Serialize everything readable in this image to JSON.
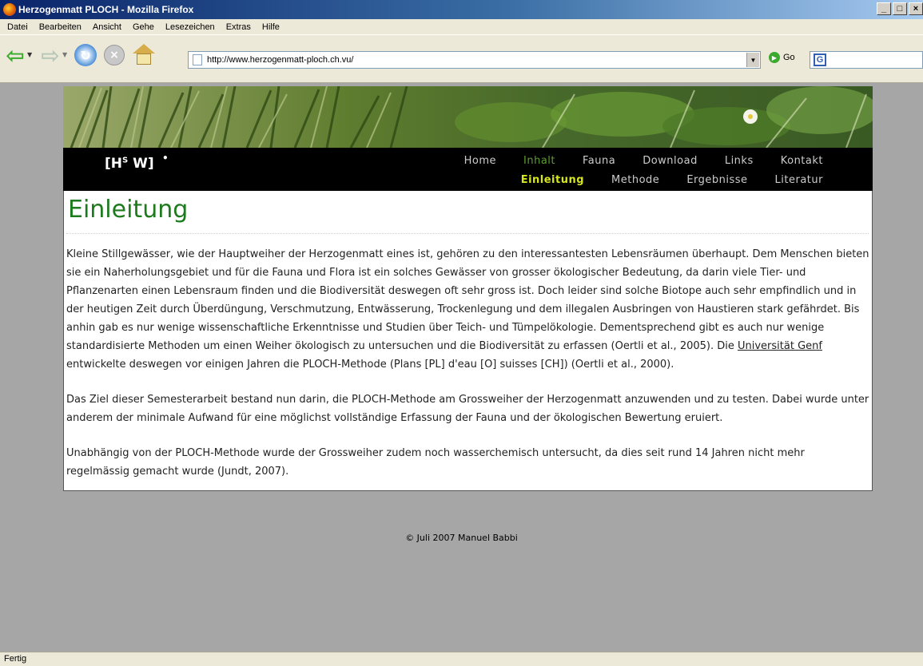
{
  "window": {
    "title": "Herzogenmatt PLOCH - Mozilla Firefox"
  },
  "menubar": [
    "Datei",
    "Bearbeiten",
    "Ansicht",
    "Gehe",
    "Lesezeichen",
    "Extras",
    "Hilfe"
  ],
  "toolbar": {
    "url": "http://www.herzogenmatt-ploch.ch.vu/",
    "go_label": "Go"
  },
  "site": {
    "logo": "[H",
    "logo_sup": "S",
    "logo_tail": " W]",
    "nav": [
      "Home",
      "Inhalt",
      "Fauna",
      "Download",
      "Links",
      "Kontakt"
    ],
    "nav_active": "Inhalt",
    "subnav": [
      "Einleitung",
      "Methode",
      "Ergebnisse",
      "Literatur"
    ],
    "subnav_active": "Einleitung"
  },
  "content": {
    "heading": "Einleitung",
    "p1_before_link": "Kleine Stillgewässer, wie der Hauptweiher der Herzogenmatt eines ist, gehören zu den interessantesten Lebensräumen überhaupt. Dem Menschen bieten sie ein Naherholungsgebiet und für die Fauna und Flora ist ein solches Gewässer von grosser ökologischer Bedeutung, da darin viele Tier- und Pflanzenarten einen Lebensraum finden und die Biodiversität deswegen oft sehr gross ist. Doch leider sind solche Biotope auch sehr empfindlich und in der heutigen Zeit durch Überdüngung, Verschmutzung, Entwässerung, Trockenlegung und dem illegalen Ausbringen von Haustieren stark gefährdet. Bis anhin gab es nur wenige wissenschaftliche Erkenntnisse und Studien über Teich- und Tümpelökologie. Dementsprechend gibt es auch nur wenige standardisierte Methoden um einen Weiher ökologisch zu untersuchen und die Biodiversität zu erfassen (Oertli et al., 2005). Die ",
    "p1_link": "Universität Genf",
    "p1_after_link": " entwickelte deswegen vor einigen Jahren die PLOCH-Methode (Plans [PL] d'eau [O] suisses [CH]) (Oertli et al., 2000).",
    "p2": "Das Ziel dieser Semesterarbeit bestand nun darin, die PLOCH-Methode am Grossweiher der Herzogenmatt anzuwenden und zu testen. Dabei wurde unter anderem der minimale Aufwand für eine möglichst vollständige Erfassung der Fauna und der ökologischen Bewertung eruiert.",
    "p3": "Unabhängig von der PLOCH-Methode wurde der Grossweiher zudem noch wasserchemisch untersucht, da dies seit rund 14 Jahren nicht mehr regelmässig gemacht wurde (Jundt, 2007)."
  },
  "footer": "© Juli 2007 Manuel Babbi",
  "status": "Fertig"
}
